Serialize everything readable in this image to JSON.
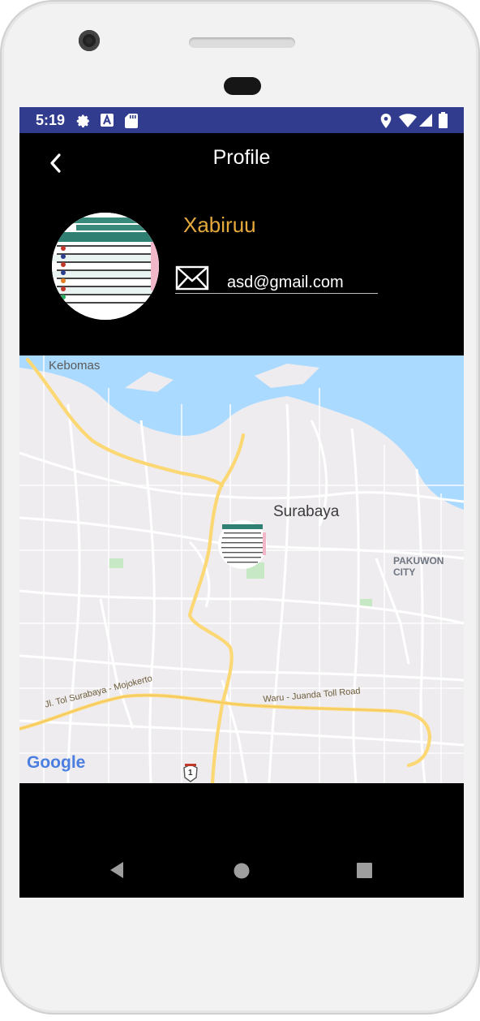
{
  "status_bar": {
    "time": "5:19",
    "left_icons": [
      "gear-icon",
      "a-icon",
      "sd-card-icon"
    ],
    "right_icons": [
      "location-icon",
      "wifi-icon",
      "signal-icon",
      "battery-icon"
    ]
  },
  "app_bar": {
    "title": "Profile",
    "back_icon": "back-arrow-icon"
  },
  "profile": {
    "avatar": "avatar-image",
    "name": "Xabiruu",
    "email": "asd@gmail.com",
    "email_icon": "mail-icon"
  },
  "map": {
    "labels": {
      "kebomas": "Kebomas",
      "surabaya": "Surabaya",
      "pakuwon": "PAKUWON CITY",
      "toll_left": "Jl. Tol Surabaya - Mojokerto",
      "toll_right": "Waru - Juanda Toll Road",
      "route_shield": "1",
      "google": "Google"
    },
    "marker": "avatar-marker"
  },
  "nav_bar": {
    "icons": [
      "nav-back-icon",
      "nav-home-icon",
      "nav-recents-icon"
    ]
  },
  "colors": {
    "status_bar": "#313c8e",
    "username": "#e6a93b",
    "map_water": "#aadaff",
    "map_land": "#eeecef",
    "map_highway": "#fcd874"
  }
}
